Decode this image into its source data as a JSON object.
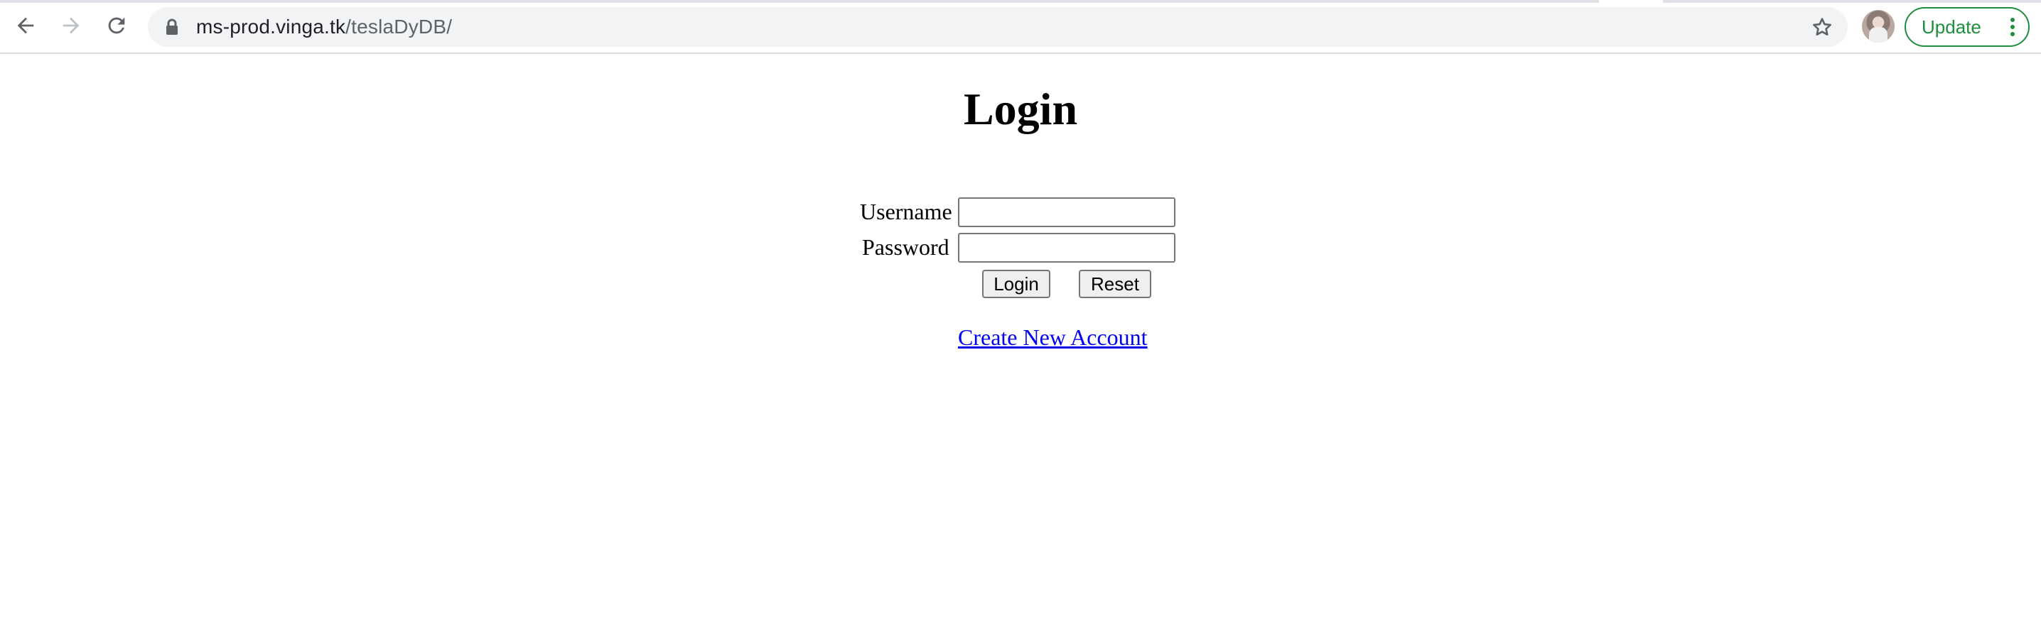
{
  "browser": {
    "url_host": "ms-prod.vinga.tk",
    "url_path": "/teslaDyDB/",
    "update_button_label": "Update",
    "accent_color": "#1e8e3e",
    "icons": [
      "back-arrow-icon",
      "forward-arrow-icon",
      "reload-icon",
      "lock-icon",
      "bookmark-star-icon",
      "profile-avatar",
      "more-vert-icon"
    ]
  },
  "page": {
    "title": "Login",
    "username_label": "Username",
    "password_label": "Password",
    "username_value": "",
    "password_value": "",
    "login_button_label": "Login",
    "reset_button_label": "Reset",
    "create_account_link": "Create New Account",
    "link_color": "#0000ee"
  }
}
